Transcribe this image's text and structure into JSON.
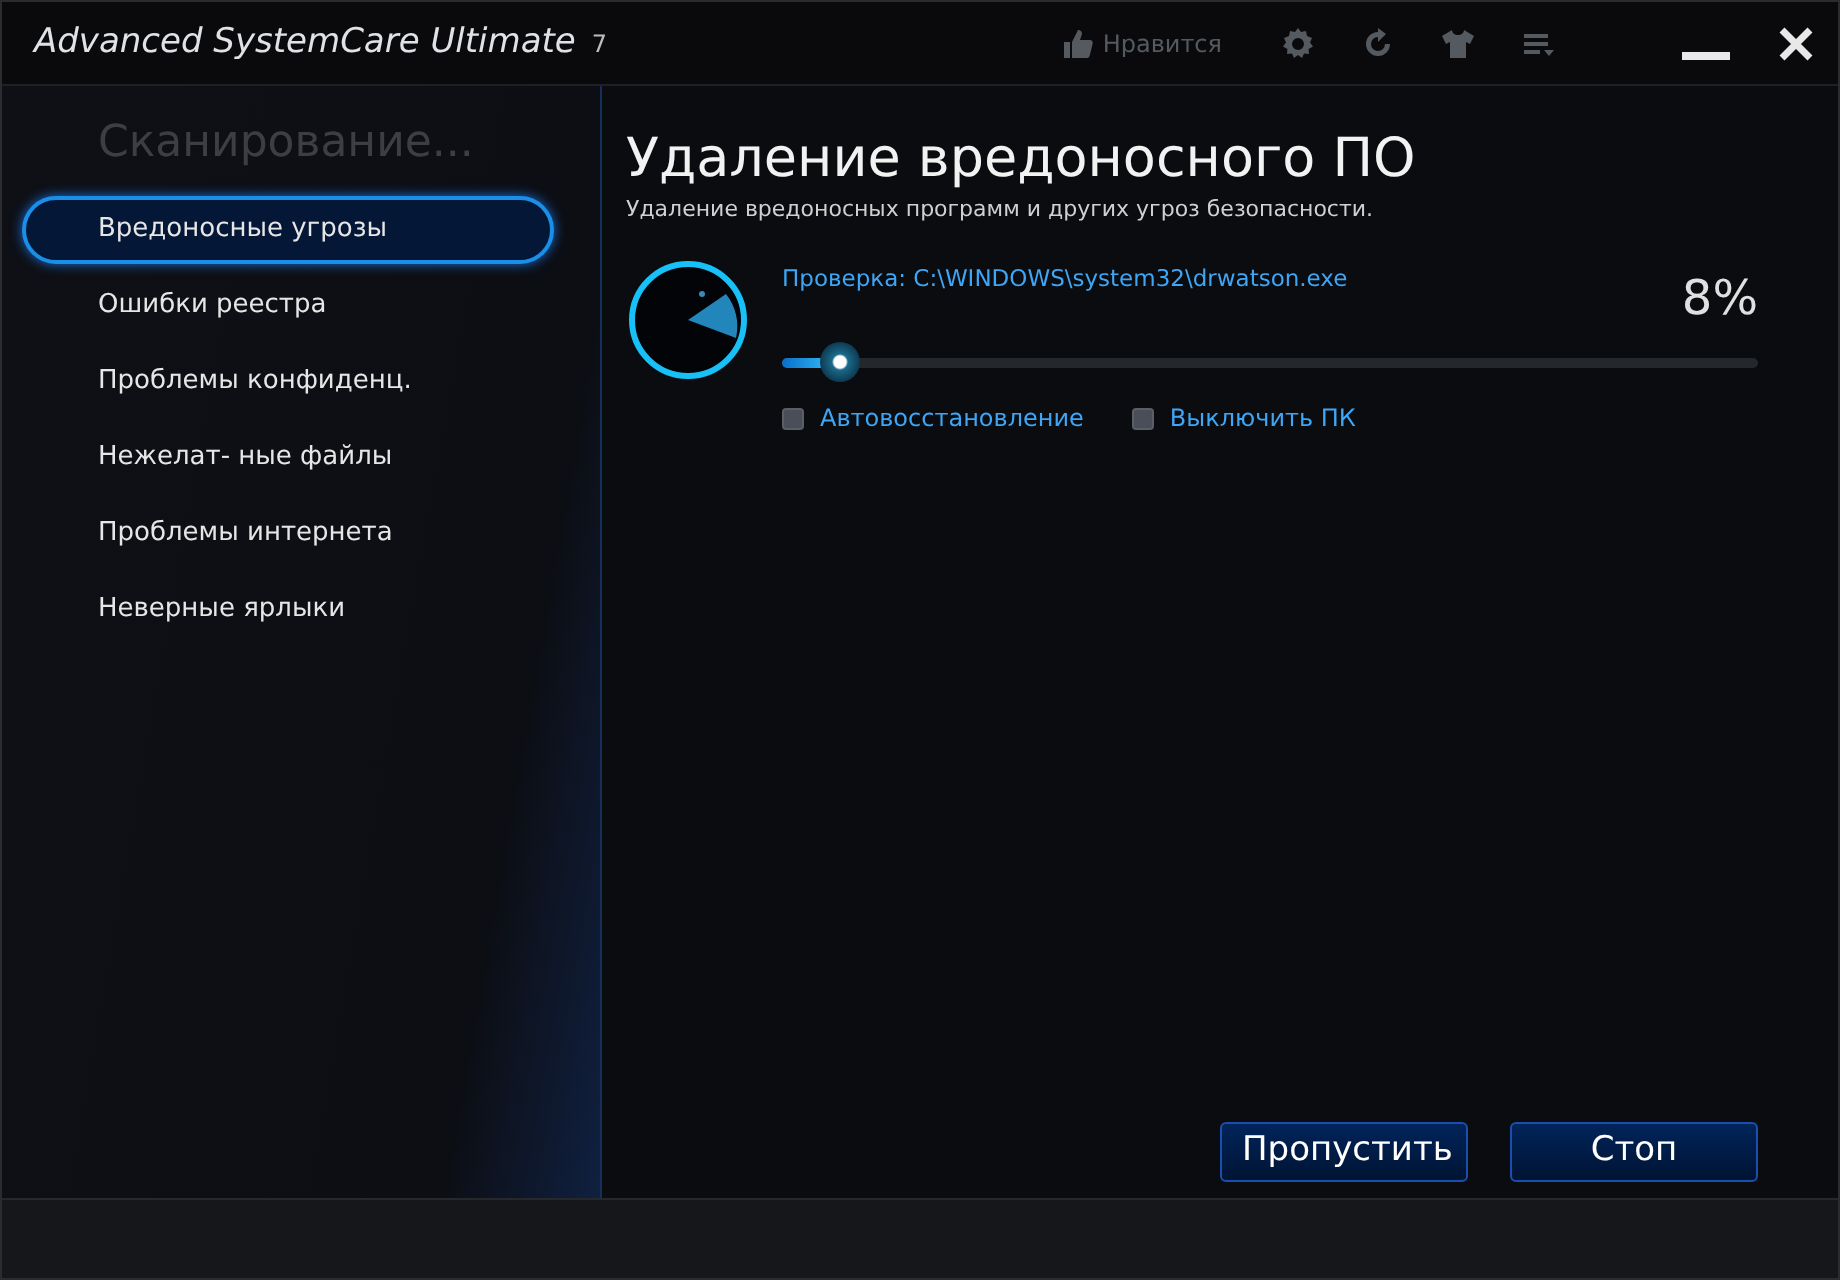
{
  "window": {
    "title": "Advanced SystemCare Ultimate",
    "version": "7",
    "like_label": "Нравится"
  },
  "sidebar": {
    "heading": "Сканирование...",
    "items": [
      {
        "label": "Вредоносные угрозы",
        "selected": true
      },
      {
        "label": "Ошибки реестра",
        "selected": false
      },
      {
        "label": "Проблемы конфиденц.",
        "selected": false
      },
      {
        "label": "Нежелат- ные файлы",
        "selected": false
      },
      {
        "label": "Проблемы интернета",
        "selected": false
      },
      {
        "label": "Неверные ярлыки",
        "selected": false
      }
    ]
  },
  "main": {
    "title": "Удаление вредоносного ПО",
    "subtitle": "Удаление вредоносных программ и других угроз безопасности.",
    "scan": {
      "path": "Проверка: C:\\WINDOWS\\system32\\drwatson.exe",
      "percent": "8%",
      "level": 0.06
    },
    "options": [
      {
        "label": "Автовосстановление",
        "checked": false
      },
      {
        "label": "Выключить ПК",
        "checked": false
      }
    ],
    "buttons": [
      "Пропустить",
      "Стоп"
    ]
  }
}
